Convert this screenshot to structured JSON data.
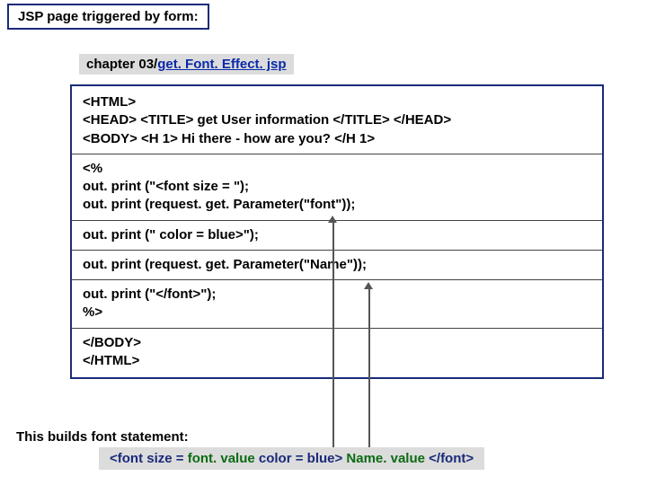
{
  "title": "JSP page triggered by form:",
  "filepath": {
    "prefix": "chapter 03/",
    "link": "get. Font. Effect. jsp"
  },
  "code": {
    "block1_l1": "<HTML>",
    "block1_l2": "<HEAD> <TITLE>   get User information  </TITLE> </HEAD>",
    "block1_l3": "<BODY> <H 1> Hi there - how are you?  </H 1>",
    "block2_l1": "<%",
    "block2_l2": "out. print (\"<font size = \");",
    "block2_l3": "out. print (request. get. Parameter(\"font\"));",
    "block3_l1": "out. print (\"  color = blue>\");",
    "block4_l1": "out. print (request. get. Parameter(\"Name\"));",
    "block5_l1": "out. print (\"</font>\");",
    "block5_l2": "%>",
    "block6_l1": "</BODY>",
    "block6_l2": "</HTML>"
  },
  "build_label": "This builds font statement:",
  "fontline": {
    "p1": "<font  size = ",
    "p2": "font. value",
    "p3": "   color = blue>  ",
    "p4": "Name. value",
    "p5": "  </font>"
  }
}
